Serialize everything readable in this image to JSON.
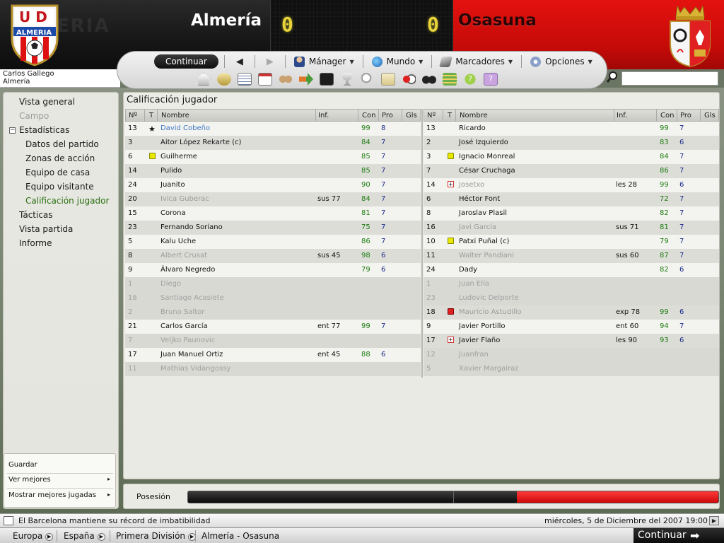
{
  "header": {
    "home_team": "Almería",
    "away_team": "Osasuna",
    "home_score": "0",
    "away_score": "0",
    "home_crest_text": "ALMERIA",
    "home_crest_letters": "U D",
    "home_watermark": "ERIA",
    "colors": {
      "home": "#141414",
      "away": "#d40d0b",
      "score": "#e6d23a"
    }
  },
  "manager": {
    "name": "Carlos Gallego",
    "club": "Almería"
  },
  "menu": {
    "continue": "Continuar",
    "items": [
      {
        "label": "Mánager",
        "icon": "manager-icon"
      },
      {
        "label": "Mundo",
        "icon": "globe-icon"
      },
      {
        "label": "Marcadores",
        "icon": "scores-icon"
      },
      {
        "label": "Opciones",
        "icon": "options-icon"
      }
    ]
  },
  "search": {
    "placeholder": ""
  },
  "sidebar": {
    "items": [
      {
        "label": "Vista general"
      },
      {
        "label": "Campo"
      },
      {
        "label": "Estadísticas"
      },
      {
        "label": "Datos del partido"
      },
      {
        "label": "Zonas de acción"
      },
      {
        "label": "Equipo de casa"
      },
      {
        "label": "Equipo visitante"
      },
      {
        "label": "Calificación jugador"
      },
      {
        "label": "Tácticas"
      },
      {
        "label": "Vista partida"
      },
      {
        "label": "Informe"
      }
    ],
    "actions": [
      {
        "label": "Guardar"
      },
      {
        "label": "Ver mejores"
      },
      {
        "label": "Mostrar mejores jugadas"
      }
    ]
  },
  "panel": {
    "title": "Calificación jugador",
    "columns": [
      "Nº",
      "T",
      "Nombre",
      "Inf.",
      "Con",
      "Pro",
      "Gls"
    ]
  },
  "home_players": [
    {
      "num": "13",
      "mark": "star",
      "name": "David Cobeño",
      "inf": "",
      "con": "99",
      "pro": "8",
      "style": "highlight"
    },
    {
      "num": "3",
      "mark": "",
      "name": "Aitor López Rekarte (c)",
      "inf": "",
      "con": "84",
      "pro": "7",
      "style": ""
    },
    {
      "num": "6",
      "mark": "yellow",
      "name": "Guilherme",
      "inf": "",
      "con": "85",
      "pro": "7",
      "style": ""
    },
    {
      "num": "14",
      "mark": "",
      "name": "Pulido",
      "inf": "",
      "con": "85",
      "pro": "7",
      "style": ""
    },
    {
      "num": "24",
      "mark": "",
      "name": "Juanito",
      "inf": "",
      "con": "90",
      "pro": "7",
      "style": ""
    },
    {
      "num": "20",
      "mark": "",
      "name": "Ivica Guberac",
      "inf": "sus 77",
      "con": "84",
      "pro": "7",
      "style": "sub"
    },
    {
      "num": "15",
      "mark": "",
      "name": "Corona",
      "inf": "",
      "con": "81",
      "pro": "7",
      "style": ""
    },
    {
      "num": "23",
      "mark": "",
      "name": "Fernando Soriano",
      "inf": "",
      "con": "75",
      "pro": "7",
      "style": ""
    },
    {
      "num": "5",
      "mark": "",
      "name": "Kalu Uche",
      "inf": "",
      "con": "86",
      "pro": "7",
      "style": ""
    },
    {
      "num": "8",
      "mark": "",
      "name": "Albert Crusat",
      "inf": "sus 45",
      "con": "98",
      "pro": "6",
      "style": "sub"
    },
    {
      "num": "9",
      "mark": "",
      "name": "Álvaro Negredo",
      "inf": "",
      "con": "79",
      "pro": "6",
      "style": ""
    },
    {
      "num": "1",
      "mark": "",
      "name": "Diego",
      "inf": "",
      "con": "",
      "pro": "",
      "style": "unused"
    },
    {
      "num": "18",
      "mark": "",
      "name": "Santiago Acasiete",
      "inf": "",
      "con": "",
      "pro": "",
      "style": "unused"
    },
    {
      "num": "2",
      "mark": "",
      "name": "Bruno Saltor",
      "inf": "",
      "con": "",
      "pro": "",
      "style": "unused"
    },
    {
      "num": "21",
      "mark": "",
      "name": "Carlos García",
      "inf": "ent 77",
      "con": "99",
      "pro": "7",
      "style": ""
    },
    {
      "num": "7",
      "mark": "",
      "name": "Veljko Paunovic",
      "inf": "",
      "con": "",
      "pro": "",
      "style": "unused"
    },
    {
      "num": "17",
      "mark": "",
      "name": "Juan Manuel Ortiz",
      "inf": "ent 45",
      "con": "88",
      "pro": "6",
      "style": ""
    },
    {
      "num": "11",
      "mark": "",
      "name": "Mathias Vidangossy",
      "inf": "",
      "con": "",
      "pro": "",
      "style": "unused"
    }
  ],
  "away_players": [
    {
      "num": "13",
      "mark": "",
      "name": "Ricardo",
      "inf": "",
      "con": "99",
      "pro": "7",
      "style": ""
    },
    {
      "num": "2",
      "mark": "",
      "name": "José Izquierdo",
      "inf": "",
      "con": "83",
      "pro": "6",
      "style": ""
    },
    {
      "num": "3",
      "mark": "yellow",
      "name": "Ignacio Monreal",
      "inf": "",
      "con": "84",
      "pro": "7",
      "style": ""
    },
    {
      "num": "7",
      "mark": "",
      "name": "César Cruchaga",
      "inf": "",
      "con": "86",
      "pro": "7",
      "style": ""
    },
    {
      "num": "14",
      "mark": "injury",
      "name": "Josetxo",
      "inf": "les 28",
      "con": "99",
      "pro": "6",
      "style": "sub"
    },
    {
      "num": "6",
      "mark": "",
      "name": "Héctor Font",
      "inf": "",
      "con": "72",
      "pro": "7",
      "style": ""
    },
    {
      "num": "8",
      "mark": "",
      "name": "Jaroslav Plasil",
      "inf": "",
      "con": "82",
      "pro": "7",
      "style": ""
    },
    {
      "num": "16",
      "mark": "",
      "name": "Javi García",
      "inf": "sus 71",
      "con": "81",
      "pro": "7",
      "style": "sub"
    },
    {
      "num": "10",
      "mark": "yellow",
      "name": "Patxi Puñal (c)",
      "inf": "",
      "con": "79",
      "pro": "7",
      "style": ""
    },
    {
      "num": "11",
      "mark": "",
      "name": "Walter Pandiani",
      "inf": "sus 60",
      "con": "87",
      "pro": "7",
      "style": "sub"
    },
    {
      "num": "24",
      "mark": "",
      "name": "Dady",
      "inf": "",
      "con": "82",
      "pro": "6",
      "style": ""
    },
    {
      "num": "1",
      "mark": "",
      "name": "Juan Elía",
      "inf": "",
      "con": "",
      "pro": "",
      "style": "unused"
    },
    {
      "num": "23",
      "mark": "",
      "name": "Ludovic Delporte",
      "inf": "",
      "con": "",
      "pro": "",
      "style": "unused"
    },
    {
      "num": "18",
      "mark": "red",
      "name": "Mauricio Astudillo",
      "inf": "exp 78",
      "con": "99",
      "pro": "6",
      "style": "sub"
    },
    {
      "num": "9",
      "mark": "",
      "name": "Javier Portillo",
      "inf": "ent 60",
      "con": "94",
      "pro": "7",
      "style": ""
    },
    {
      "num": "17",
      "mark": "injury",
      "name": "Javier Flaño",
      "inf": "les 90",
      "con": "93",
      "pro": "6",
      "style": ""
    },
    {
      "num": "12",
      "mark": "",
      "name": "Juanfran",
      "inf": "",
      "con": "",
      "pro": "",
      "style": "unused"
    },
    {
      "num": "5",
      "mark": "",
      "name": "Xavier Margairaz",
      "inf": "",
      "con": "",
      "pro": "",
      "style": "unused"
    }
  ],
  "possession": {
    "label": "Posesión",
    "home_fraction": 0.62,
    "away_fraction": 0.38
  },
  "ticker": {
    "news": "El Barcelona mantiene su récord de imbatibilidad",
    "date": "miércoles, 5 de Diciembre del 2007 19:00"
  },
  "bottom": {
    "crumbs": [
      "Europa",
      "España",
      "Primera División",
      "Almería - Osasuna"
    ],
    "continue": "Continuar"
  }
}
